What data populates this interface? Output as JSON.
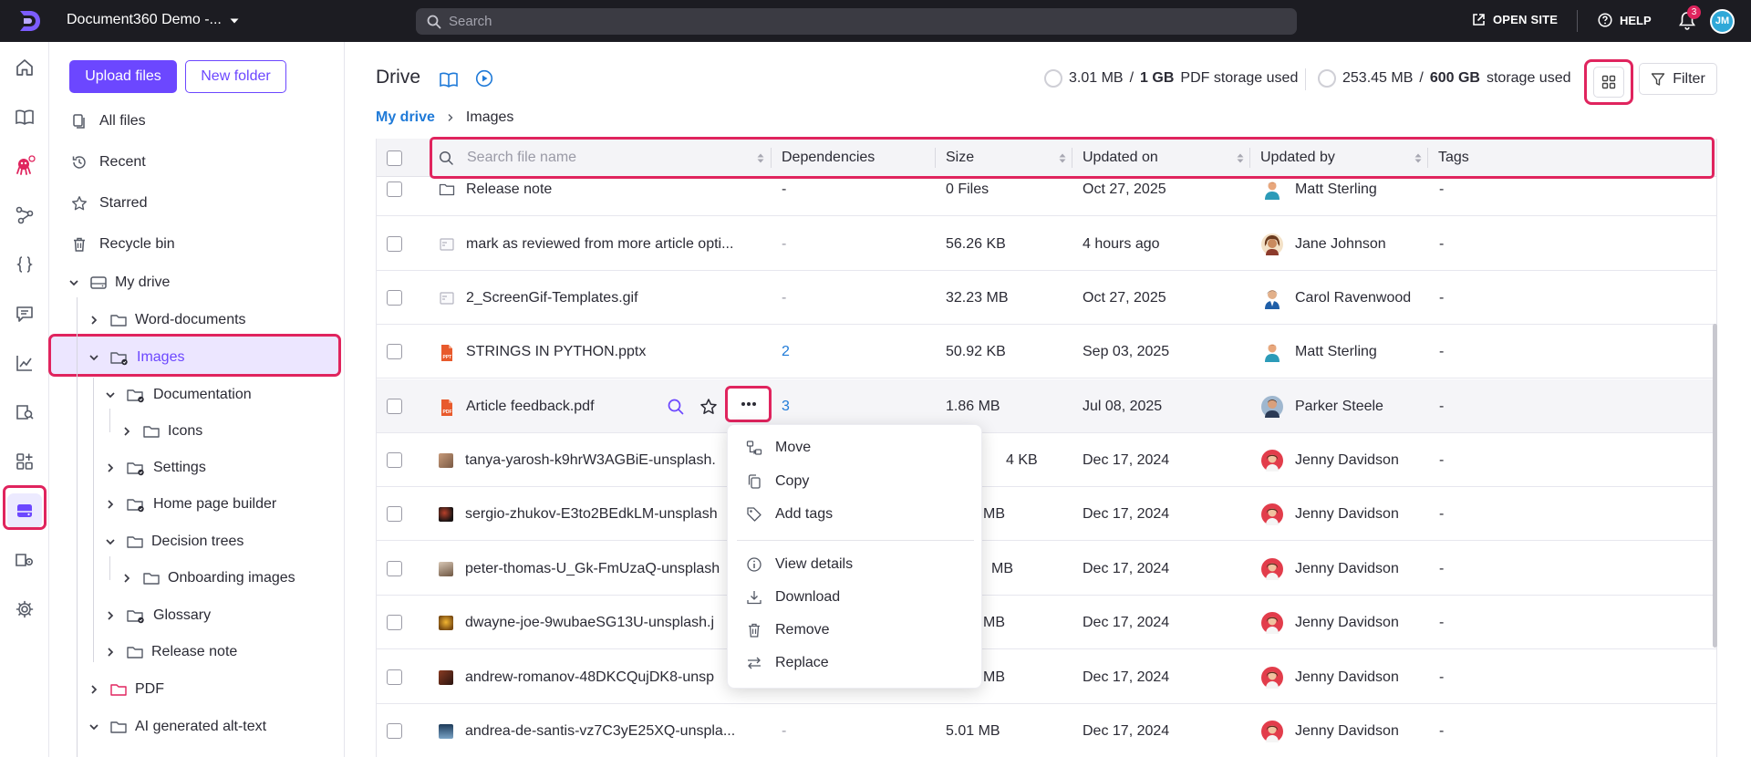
{
  "topbar": {
    "project_name": "Document360 Demo -...",
    "search_placeholder": "Search",
    "open_site": "OPEN SITE",
    "help": "HELP",
    "notif_count": "3",
    "avatar_initials": "JM"
  },
  "sidebar": {
    "upload_label": "Upload files",
    "new_folder_label": "New folder",
    "nav": [
      {
        "label": "All files",
        "icon": "files-icon"
      },
      {
        "label": "Recent",
        "icon": "history-icon"
      },
      {
        "label": "Starred",
        "icon": "star-icon"
      },
      {
        "label": "Recycle bin",
        "icon": "trash-icon"
      }
    ],
    "tree": [
      {
        "label": "My drive",
        "expanded": true,
        "level": 0
      },
      {
        "label": "Word-documents",
        "expanded": false,
        "level": 1
      },
      {
        "label": "Images",
        "expanded": true,
        "level": 1,
        "selected": true
      },
      {
        "label": "Documentation",
        "expanded": true,
        "level": 2
      },
      {
        "label": "Icons",
        "expanded": false,
        "level": 3
      },
      {
        "label": "Settings",
        "expanded": false,
        "level": 2
      },
      {
        "label": "Home page builder",
        "expanded": false,
        "level": 2
      },
      {
        "label": "Decision trees",
        "expanded": true,
        "level": 2
      },
      {
        "label": "Onboarding images",
        "expanded": false,
        "level": 3
      },
      {
        "label": "Glossary",
        "expanded": false,
        "level": 2
      },
      {
        "label": "Release note",
        "expanded": false,
        "level": 2
      },
      {
        "label": "PDF",
        "expanded": false,
        "level": 1
      },
      {
        "label": "AI generated alt-text",
        "expanded": true,
        "level": 1
      }
    ]
  },
  "main": {
    "title": "Drive",
    "pdf_storage": {
      "used": "3.01 MB",
      "sep": "/",
      "total": "1 GB",
      "label": "PDF storage used"
    },
    "storage": {
      "used": "253.45 MB",
      "sep": "/",
      "total": "600 GB",
      "label": "storage used"
    },
    "filter_label": "Filter",
    "breadcrumb": {
      "root": "My drive",
      "current": "Images"
    }
  },
  "table": {
    "search_placeholder": "Search file name",
    "columns": [
      "Dependencies",
      "Size",
      "Updated on",
      "Updated by",
      "Tags"
    ],
    "rows": [
      {
        "name": "Release note",
        "type": "folder",
        "deps": "-",
        "size": "0 Files",
        "updated": "Oct 27, 2025",
        "by": "Matt Sterling",
        "tags": "-"
      },
      {
        "name": "mark as reviewed from more article opti...",
        "type": "gif",
        "deps": "-",
        "size": "56.26 KB",
        "updated": "4 hours ago",
        "by": "Jane Johnson",
        "tags": "-"
      },
      {
        "name": "2_ScreenGif-Templates.gif",
        "type": "gif",
        "deps": "-",
        "size": "32.23 MB",
        "updated": "Oct 27, 2025",
        "by": "Carol Ravenwood",
        "tags": "-"
      },
      {
        "name": "STRINGS IN PYTHON.pptx",
        "type": "ppt",
        "deps": "2",
        "size": "50.92 KB",
        "updated": "Sep 03, 2025",
        "by": "Matt Sterling",
        "tags": "-"
      },
      {
        "name": "Article feedback.pdf",
        "type": "pdf",
        "deps": "3",
        "size": "1.86 MB",
        "updated": "Jul 08, 2025",
        "by": "Parker Steele",
        "tags": "-"
      },
      {
        "name": "tanya-yarosh-k9hrW3AGBiE-unsplash.",
        "type": "img",
        "deps": "",
        "size": "4 KB",
        "updated": "Dec 17, 2024",
        "by": "Jenny Davidson",
        "tags": "-"
      },
      {
        "name": "sergio-zhukov-E3to2BEdkLM-unsplash",
        "type": "img",
        "deps": "",
        "size": "MB",
        "updated": "Dec 17, 2024",
        "by": "Jenny Davidson",
        "tags": "-"
      },
      {
        "name": "peter-thomas-U_Gk-FmUzaQ-unsplash",
        "type": "img",
        "deps": "",
        "size": "MB",
        "updated": "Dec 17, 2024",
        "by": "Jenny Davidson",
        "tags": "-"
      },
      {
        "name": "dwayne-joe-9wubaeSG13U-unsplash.j",
        "type": "img",
        "deps": "",
        "size": "MB",
        "updated": "Dec 17, 2024",
        "by": "Jenny Davidson",
        "tags": "-"
      },
      {
        "name": "andrew-romanov-48DKCQujDK8-unsp",
        "type": "img",
        "deps": "",
        "size": "MB",
        "updated": "Dec 17, 2024",
        "by": "Jenny Davidson",
        "tags": "-"
      },
      {
        "name": "andrea-de-santis-vz7C3yE25XQ-unspla...",
        "type": "img",
        "deps": "-",
        "size": "5.01 MB",
        "updated": "Dec 17, 2024",
        "by": "Jenny Davidson",
        "tags": "-"
      }
    ]
  },
  "context_menu": {
    "items": [
      {
        "label": "Move",
        "icon": "move-icon"
      },
      {
        "label": "Copy",
        "icon": "copy-icon"
      },
      {
        "label": "Add tags",
        "icon": "tag-icon"
      },
      {
        "label": "View details",
        "icon": "info-icon"
      },
      {
        "label": "Download",
        "icon": "download-icon"
      },
      {
        "label": "Remove",
        "icon": "trash-icon"
      },
      {
        "label": "Replace",
        "icon": "replace-icon"
      }
    ]
  },
  "colors": {
    "accent": "#6c47ff",
    "highlight": "#e0245e",
    "link": "#1f7ad8",
    "topbar": "#1c1c22"
  }
}
